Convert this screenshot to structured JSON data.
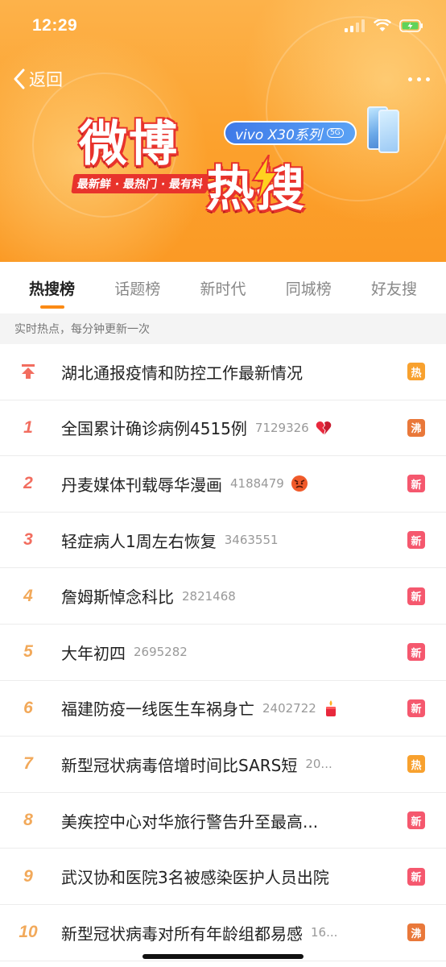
{
  "status_bar": {
    "time": "12:29"
  },
  "nav": {
    "back_label": "返回"
  },
  "banner": {
    "logo_line1": "微博",
    "logo_line2": "热搜",
    "slogan": "最新鲜 · 最热门 · 最有料",
    "sponsor": "vivo X30系列",
    "sponsor_badge": "5G"
  },
  "tabs": [
    {
      "label": "热搜榜",
      "active": true
    },
    {
      "label": "话题榜",
      "active": false
    },
    {
      "label": "新时代",
      "active": false
    },
    {
      "label": "同城榜",
      "active": false
    },
    {
      "label": "好友搜",
      "active": false
    }
  ],
  "subheader": "实时热点，每分钟更新一次",
  "list": [
    {
      "rank": "",
      "title": "湖北通报疫情和防控工作最新情况",
      "count": "",
      "emoji": "",
      "badge": "热"
    },
    {
      "rank": "1",
      "title": "全国累计确诊病例4515例",
      "count": "7129326",
      "emoji": "broken-heart-icon",
      "badge": "沸"
    },
    {
      "rank": "2",
      "title": "丹麦媒体刊载辱华漫画",
      "count": "4188479",
      "emoji": "angry-face-icon",
      "badge": "新"
    },
    {
      "rank": "3",
      "title": "轻症病人1周左右恢复",
      "count": "3463551",
      "emoji": "",
      "badge": "新"
    },
    {
      "rank": "4",
      "title": "詹姆斯悼念科比",
      "count": "2821468",
      "emoji": "",
      "badge": "新"
    },
    {
      "rank": "5",
      "title": "大年初四",
      "count": "2695282",
      "emoji": "",
      "badge": "新"
    },
    {
      "rank": "6",
      "title": "福建防疫一线医生车祸身亡",
      "count": "2402722",
      "emoji": "candle-icon",
      "badge": "新"
    },
    {
      "rank": "7",
      "title": "新型冠状病毒倍增时间比SARS短",
      "count": "20...",
      "emoji": "",
      "badge": "热"
    },
    {
      "rank": "8",
      "title": "美疾控中心对华旅行警告升至最高...",
      "count": "",
      "emoji": "",
      "badge": "新"
    },
    {
      "rank": "9",
      "title": "武汉协和医院3名被感染医护人员出院",
      "count": "",
      "emoji": "",
      "badge": "新"
    },
    {
      "rank": "10",
      "title": "新型冠状病毒对所有年龄组都易感",
      "count": "16...",
      "emoji": "",
      "badge": "沸"
    }
  ],
  "colors": {
    "banner": "#fca12d",
    "accent": "#fb8a14",
    "rank_top": "#f26d5f",
    "rank_mid": "#f2a95a",
    "badge_hot": "#f8a12e",
    "badge_new": "#f5586e",
    "badge_boil": "#e9783a"
  }
}
